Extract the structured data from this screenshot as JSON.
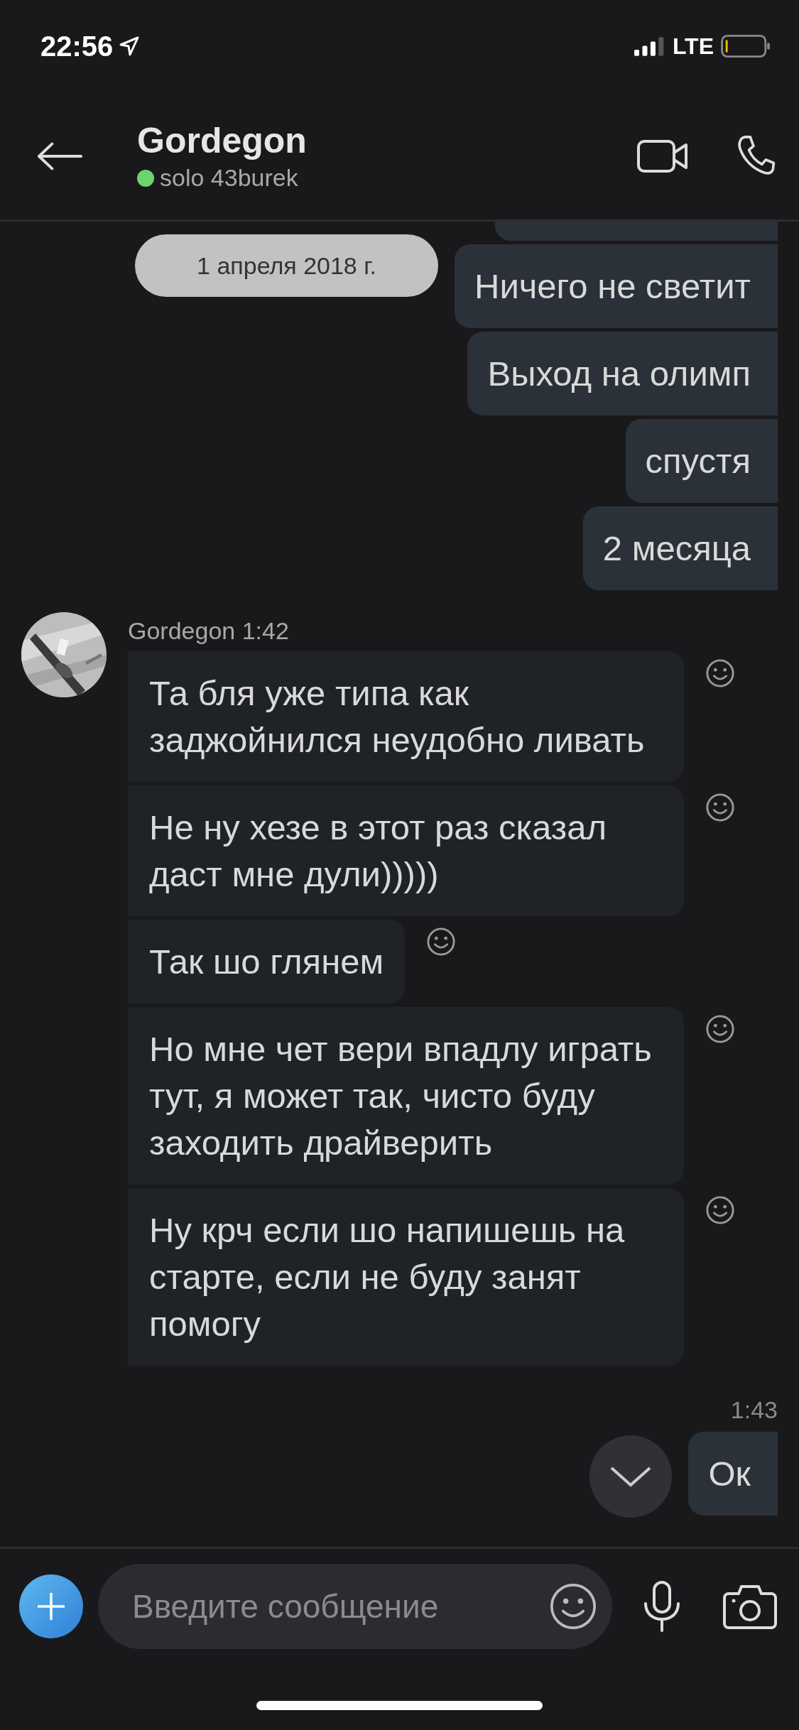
{
  "status_bar": {
    "time": "22:56",
    "network": "LTE"
  },
  "header": {
    "title": "Gordegon",
    "status_text": "solo 43burek",
    "online": true
  },
  "date_label": "1 апреля 2018 г.",
  "messages": [
    {
      "kind": "stub"
    },
    {
      "kind": "sent",
      "text": "Ничего не светит"
    },
    {
      "kind": "sent",
      "text": "Выход на олимп"
    },
    {
      "kind": "sent",
      "text": "спустя"
    },
    {
      "kind": "sent",
      "text": "2 месяца"
    },
    {
      "kind": "sender",
      "text": "Gordegon 1:42"
    },
    {
      "kind": "received",
      "text": "Та бля уже типа как заджойнился неудобно ливать"
    },
    {
      "kind": "received",
      "text": "Не ну хезе в этот раз сказал даст мне дули)))))"
    },
    {
      "kind": "received",
      "text": "Так шо глянем"
    },
    {
      "kind": "received",
      "text": "Но мне чет вери впадлу играть тут, я может так, чисто буду заходить драйверить"
    },
    {
      "kind": "received",
      "text": "Ну крч если шо напишешь на старте, если не буду занят помогу"
    },
    {
      "kind": "time",
      "text": "1:43"
    },
    {
      "kind": "sent",
      "text": "Ок"
    }
  ],
  "composer": {
    "placeholder": "Введите сообщение"
  }
}
